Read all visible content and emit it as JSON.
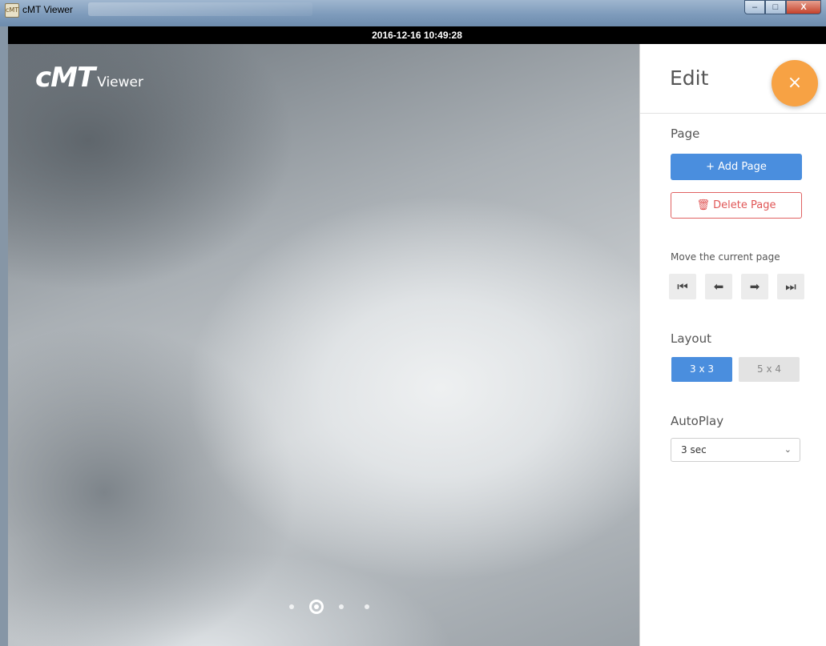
{
  "window": {
    "title": "cMT Viewer",
    "controls": {
      "minimize": "–",
      "maximize": "□",
      "close": "X"
    }
  },
  "timebar": {
    "datetime": "2016-12-16 10:49:28"
  },
  "logo": {
    "main": "cMT",
    "sub": "Viewer"
  },
  "pager": {
    "count": 4,
    "active_index": 1
  },
  "panel": {
    "title": "Edit",
    "close_icon": "×",
    "page_section": {
      "label": "Page",
      "add_label": "+ Add Page",
      "delete_label": "Delete Page",
      "delete_icon": "🗑"
    },
    "move_section": {
      "label": "Move the current page",
      "buttons": [
        {
          "name": "move-first-button",
          "icon": "⏮"
        },
        {
          "name": "move-prev-button",
          "icon": "⬅"
        },
        {
          "name": "move-next-button",
          "icon": "➡"
        },
        {
          "name": "move-last-button",
          "icon": "⏭"
        }
      ]
    },
    "layout_section": {
      "label": "Layout",
      "options": [
        "3 x 3",
        "5 x 4"
      ],
      "selected": "3 x 3"
    },
    "autoplay_section": {
      "label": "AutoPlay",
      "value": "3 sec"
    }
  },
  "colors": {
    "accent_blue": "#4a8ede",
    "delete_red": "#e05555",
    "fab_orange": "#f7a244"
  }
}
